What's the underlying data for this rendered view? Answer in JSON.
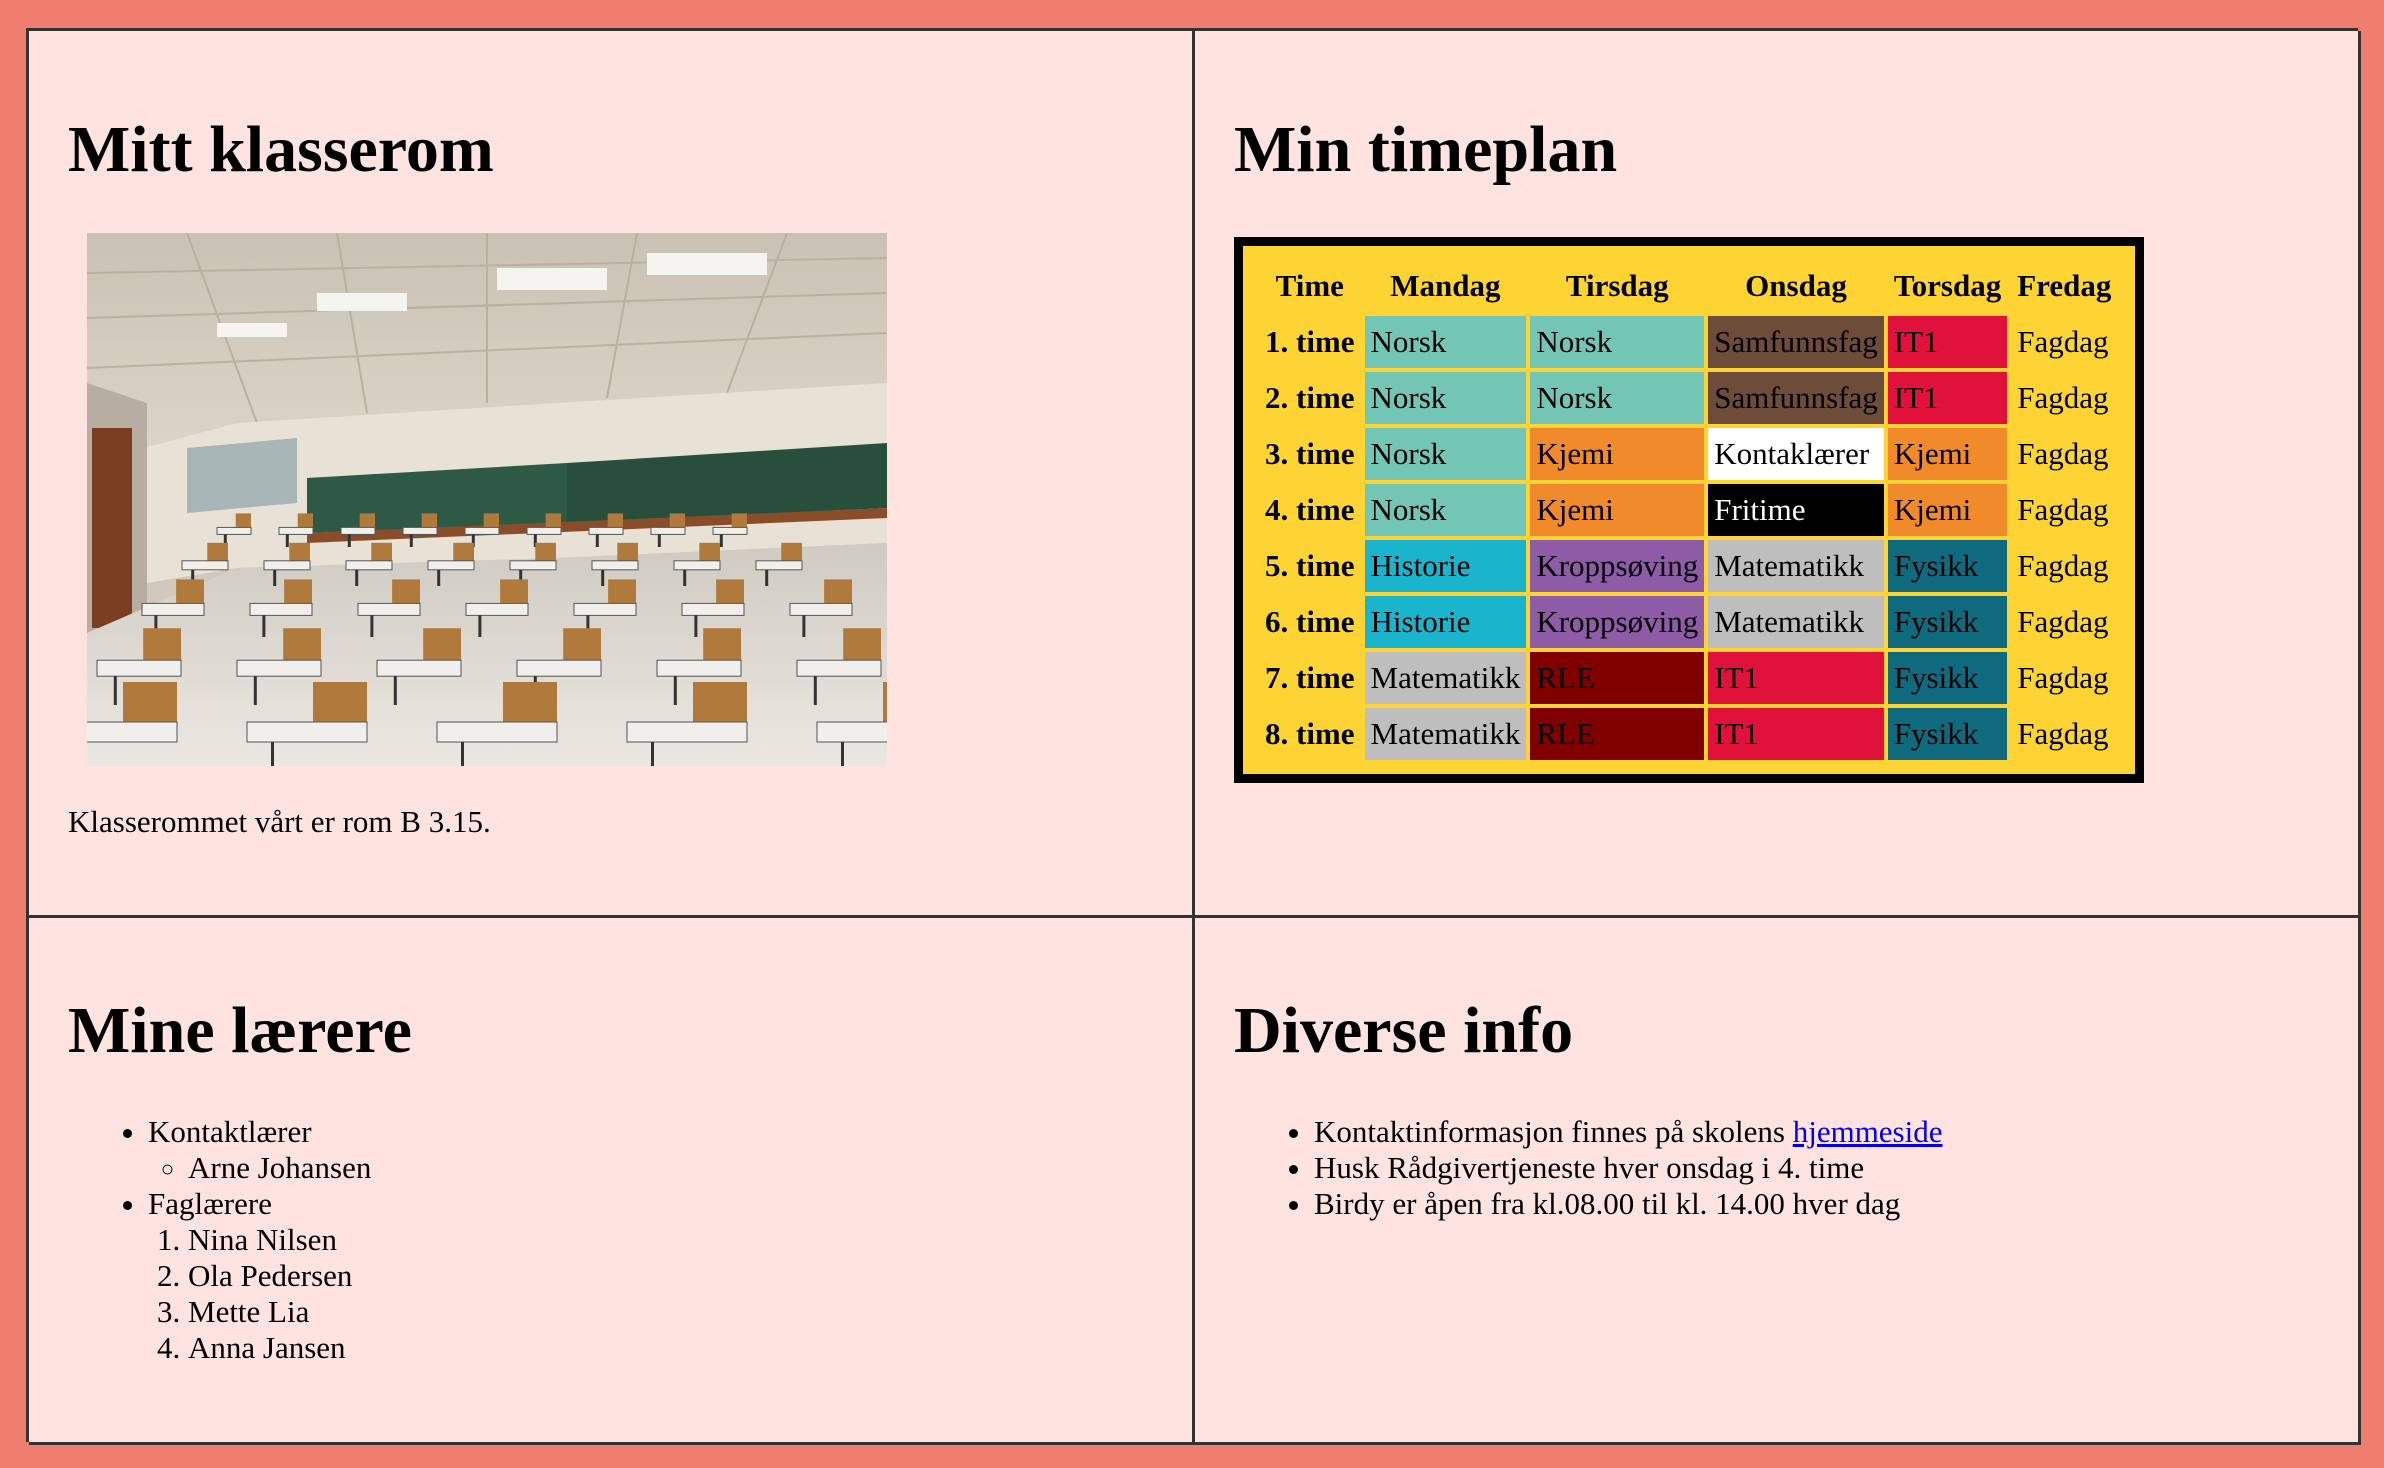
{
  "classroom": {
    "title": "Mitt klasserom",
    "caption": "Klasserommet vårt er rom B 3.15."
  },
  "schedule": {
    "title": "Min timeplan",
    "headers": [
      "Time",
      "Mandag",
      "Tirsdag",
      "Onsdag",
      "Torsdag",
      "Fredag"
    ],
    "rows": [
      {
        "time": "1. time",
        "cells": [
          "Norsk",
          "Norsk",
          "Samfunnsfag",
          "IT1",
          "Fagdag"
        ]
      },
      {
        "time": "2. time",
        "cells": [
          "Norsk",
          "Norsk",
          "Samfunnsfag",
          "IT1",
          "Fagdag"
        ]
      },
      {
        "time": "3. time",
        "cells": [
          "Norsk",
          "Kjemi",
          "Kontaklærer",
          "Kjemi",
          "Fagdag"
        ]
      },
      {
        "time": "4. time",
        "cells": [
          "Norsk",
          "Kjemi",
          "Fritime",
          "Kjemi",
          "Fagdag"
        ]
      },
      {
        "time": "5. time",
        "cells": [
          "Historie",
          "Kroppsøving",
          "Matematikk",
          "Fysikk",
          "Fagdag"
        ]
      },
      {
        "time": "6. time",
        "cells": [
          "Historie",
          "Kroppsøving",
          "Matematikk",
          "Fysikk",
          "Fagdag"
        ]
      },
      {
        "time": "7. time",
        "cells": [
          "Matematikk",
          "RLE",
          "IT1",
          "Fysikk",
          "Fagdag"
        ]
      },
      {
        "time": "8. time",
        "cells": [
          "Matematikk",
          "RLE",
          "IT1",
          "Fysikk",
          "Fagdag"
        ]
      }
    ],
    "subject_colors": {
      "Norsk": {
        "bg": "#73C6B6",
        "fg": "#000000"
      },
      "Samfunnsfag": {
        "bg": "#6E4C3A",
        "fg": "#000000"
      },
      "IT1": {
        "bg": "#E0113B",
        "fg": "#000000"
      },
      "Kjemi": {
        "bg": "#F08A2A",
        "fg": "#000000"
      },
      "Kontaklærer": {
        "bg": "#FFFFFF",
        "fg": "#000000"
      },
      "Fritime": {
        "bg": "#000000",
        "fg": "#FFFFFF"
      },
      "Historie": {
        "bg": "#1AB4CC",
        "fg": "#000000"
      },
      "Kroppsøving": {
        "bg": "#8E5BA6",
        "fg": "#000000"
      },
      "Matematikk": {
        "bg": "#BEBEBE",
        "fg": "#000000"
      },
      "Fysikk": {
        "bg": "#0F6A7E",
        "fg": "#000000"
      },
      "RLE": {
        "bg": "#800000",
        "fg": "#000000"
      },
      "Fagdag": {
        "bg": "transparent",
        "fg": "#000000"
      }
    }
  },
  "teachers": {
    "title": "Mine lærere",
    "contact_label": "Kontaktlærer",
    "contact_teacher": "Arne Johansen",
    "subject_label": "Faglærere",
    "subject_teachers": [
      "Nina Nilsen",
      "Ola Pedersen",
      "Mette Lia",
      "Anna Jansen"
    ]
  },
  "info": {
    "title": "Diverse info",
    "item1_text": "Kontaktinformasjon finnes på skolens ",
    "item1_link": "hjemmeside",
    "item2": "Husk Rådgivertjeneste hver onsdag i 4. time",
    "item3": "Birdy er åpen fra kl.08.00 til kl. 14.00 hver dag"
  },
  "colors": {
    "page_border": "#F07E6E",
    "panel_bg": "#FFE3E0",
    "timetable_bg": "#FDD434",
    "link": "#0000EE"
  }
}
